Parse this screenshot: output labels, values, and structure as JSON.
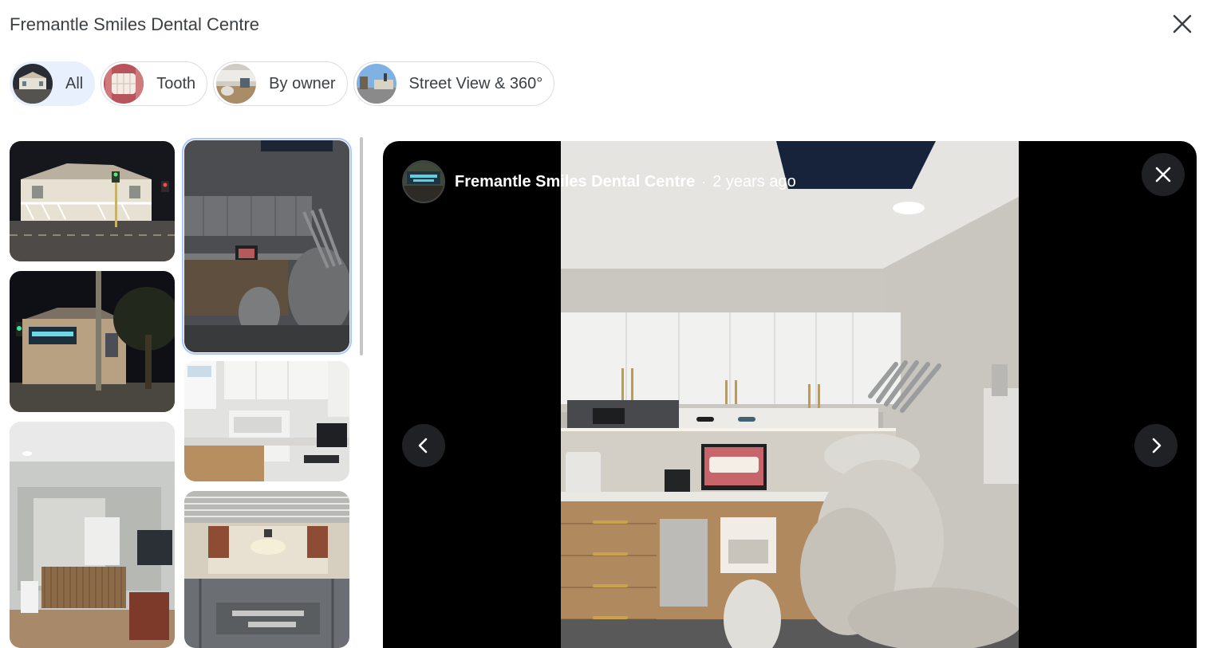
{
  "header": {
    "title": "Fremantle Smiles Dental Centre"
  },
  "filters": [
    {
      "label": "All",
      "active": true
    },
    {
      "label": "Tooth",
      "active": false
    },
    {
      "label": "By owner",
      "active": false
    },
    {
      "label": "Street View & 360°",
      "active": false
    }
  ],
  "viewer": {
    "author": "Fremantle Smiles Dental Centre",
    "separator": "·",
    "age": "2 years ago"
  },
  "icons": {
    "close": "close-icon",
    "prev": "chevron-left-icon",
    "next": "chevron-right-icon"
  },
  "colors": {
    "chip_active_bg": "#e8f0fe",
    "selected_outline": "#a8c7fa",
    "viewer_bg": "#000000"
  }
}
